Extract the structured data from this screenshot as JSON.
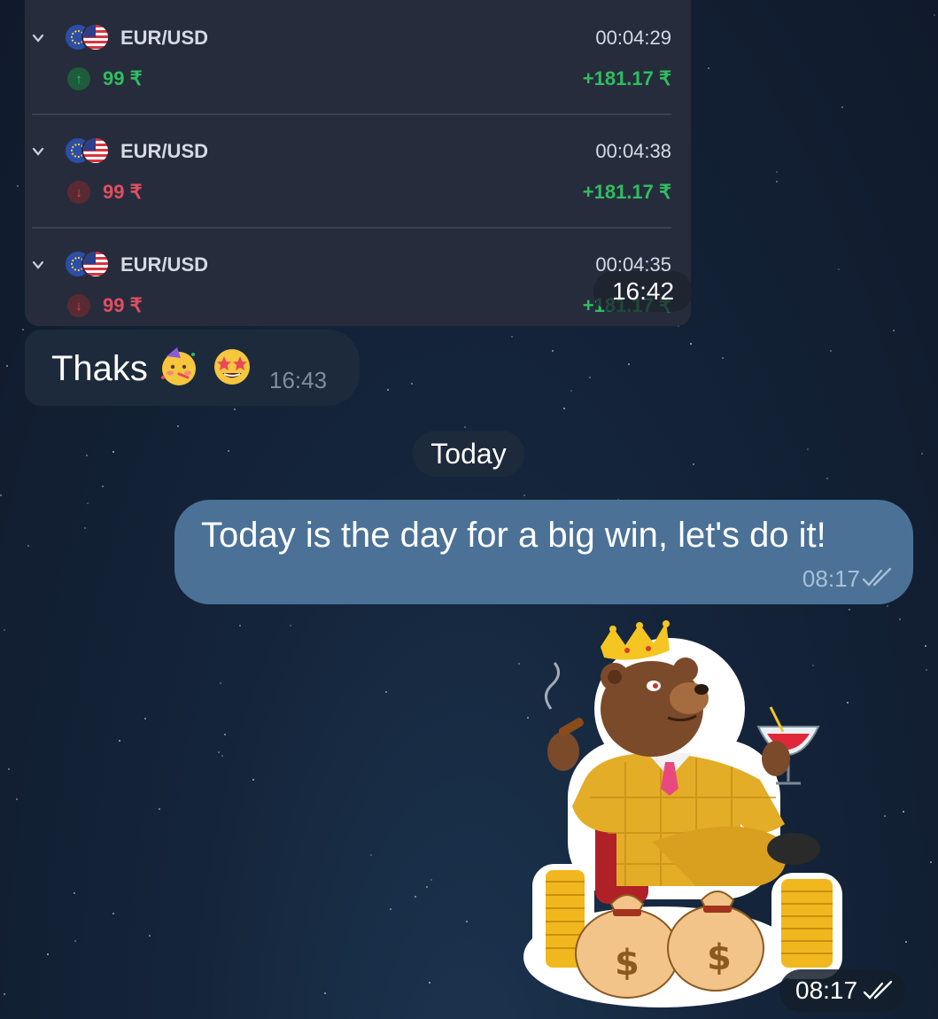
{
  "trades": [
    {
      "pair": "EUR/USD",
      "time": "00:04:29",
      "amount": "99 ₹",
      "direction": "up",
      "payout": "+181.17 ₹"
    },
    {
      "pair": "EUR/USD",
      "time": "00:04:38",
      "amount": "99 ₹",
      "direction": "down",
      "payout": "+181.17 ₹"
    },
    {
      "pair": "EUR/USD",
      "time": "00:04:35",
      "amount": "99 ₹",
      "direction": "down",
      "payout": "+181.17 ₹"
    }
  ],
  "trades_card": {
    "time": "16:42"
  },
  "incoming_message": {
    "text": "Thaks",
    "emojis": [
      "partying-face-icon",
      "star-struck-icon"
    ],
    "time": "16:43"
  },
  "date_separator": {
    "label": "Today"
  },
  "outgoing_message": {
    "text": "Today is the day for a big win, let's do it!",
    "time": "08:17",
    "status": "read"
  },
  "sticker": {
    "description_icon": "bear-king-money-sticker",
    "time": "08:17",
    "status": "read"
  },
  "colors": {
    "outgoing_bubble": "#4b7196",
    "incoming_bubble": "#1d2a3b",
    "profit": "#2fbe5f",
    "loss": "#e04f5f"
  }
}
